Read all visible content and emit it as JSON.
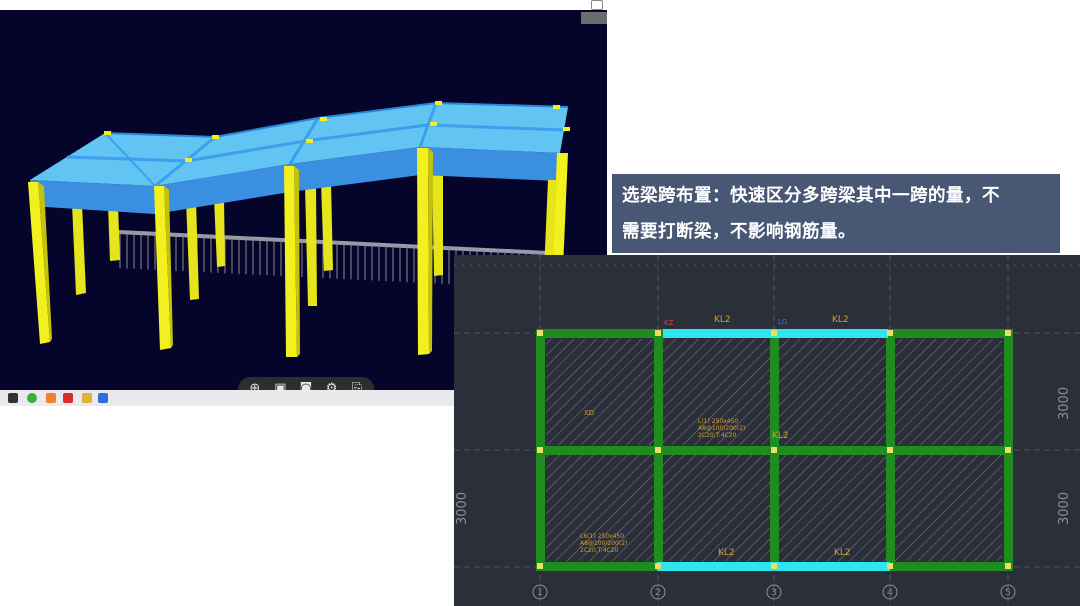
{
  "caption": {
    "line1": "选梁跨布置：快速区分多跨梁其中一跨的量，不",
    "line2": "需要打断梁，不影响钢筋量。"
  },
  "viewer": {
    "toolbar": [
      "grid-view-icon",
      "cube-view-icon",
      "camera-icon",
      "settings-icon",
      "export-icon"
    ],
    "colors": {
      "background": "#05052b",
      "slab": "#4aa8e8",
      "column": "#f2f01e",
      "railing": "#9a9aa6"
    }
  },
  "cad": {
    "grid_numbers": [
      "1",
      "2",
      "3",
      "4",
      "5"
    ],
    "dims": {
      "right_top": "3000",
      "right_bottom": "3000",
      "left_bottom": "3000"
    },
    "beams": {
      "top_left": "KL2",
      "top_right": "KL2",
      "top_mark": "LG",
      "middle": "KL2",
      "bottom_left": "KL2",
      "bottom_right": "KL2"
    },
    "annot": {
      "kz": "KZ",
      "xd": "XD",
      "beam_note_1": "L(1) 250x450",
      "beam_note_2": "A8@100/200(2)",
      "beam_note_3": "2C20;T:4C20",
      "beam_note_4": "L6(1) 250x450",
      "beam_note_5": "A8@100/200(2)",
      "beam_note_6": "2C20;T:4C20"
    },
    "colors": {
      "background": "#2b2f3a",
      "beam": "#1e8c1e",
      "selected": "#2de6f0",
      "text": "#d4a02a"
    }
  }
}
